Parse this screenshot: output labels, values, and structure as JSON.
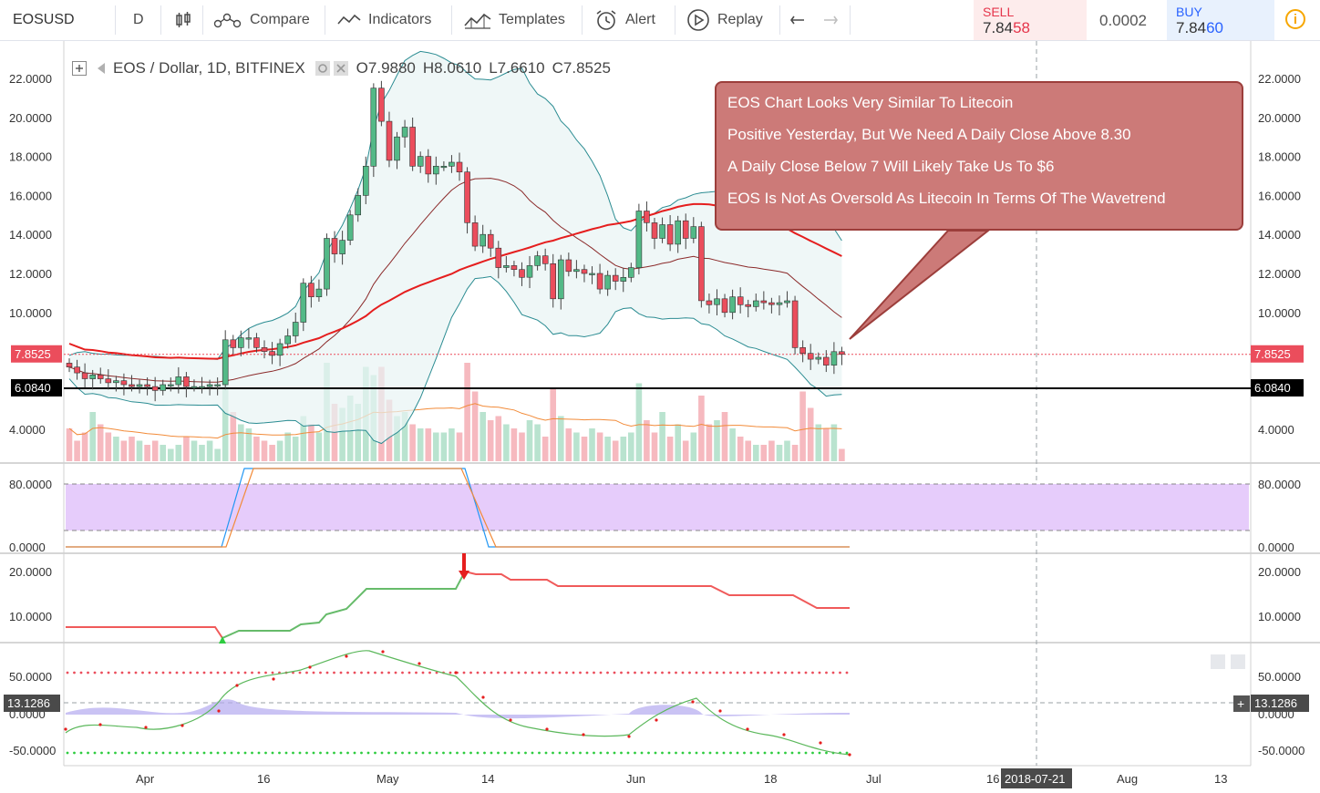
{
  "toolbar": {
    "symbol": "EOSUSD",
    "interval": "D",
    "compare": "Compare",
    "indicators": "Indicators",
    "templates": "Templates",
    "alert": "Alert",
    "replay": "Replay",
    "sell_label": "SELL",
    "sell_price_main": "7.84",
    "sell_price_big": "58",
    "spread": "0.0002",
    "buy_label": "BUY",
    "buy_price_main": "7.84",
    "buy_price_big": "60",
    "alert_icon_text": "i"
  },
  "legend": {
    "title": "EOS / Dollar, 1D, BITFINEX",
    "open": "O7.9880",
    "high": "H8.0610",
    "low": "L7.6610",
    "close": "C7.8525"
  },
  "note": {
    "lines": [
      "EOS Chart Looks Very Similar To Litecoin",
      "Positive Yesterday, But We Need A Daily Close Above 8.30",
      "A Daily Close Below 7 Will Likely Take Us To $6",
      "EOS Is Not As Oversold As Litecoin In Terms Of The Wavetrend"
    ]
  },
  "colors": {
    "up": "#53b987",
    "down": "#eb4d5c",
    "volume_up": "#b9e3cf",
    "volume_down": "#f6b9bf",
    "ma_red": "#e51e1e",
    "bb": "#2b8c92",
    "ma_brown": "#8b2a2a",
    "stoch_fill": "#e6ccfb",
    "accent": "#2196f3"
  },
  "price_axis": {
    "ticks": [
      "22.0000",
      "20.0000",
      "18.0000",
      "16.0000",
      "14.0000",
      "12.0000",
      "10.0000",
      "4.0000"
    ],
    "current_price": "7.8525",
    "hline_price": "6.0840"
  },
  "stoch_axis": {
    "ticks": [
      "80.0000",
      "0.0000"
    ]
  },
  "trend_axis": {
    "ticks": [
      "20.0000",
      "10.0000"
    ]
  },
  "wave_axis": {
    "ticks": [
      "50.0000",
      "0.0000",
      "-50.0000"
    ],
    "current": "13.1286"
  },
  "time_axis": {
    "labels": [
      "Apr",
      "16",
      "May",
      "14",
      "Jun",
      "18",
      "Jul",
      "16",
      "Aug",
      "13"
    ],
    "crosshair_date": "2018-07-21"
  },
  "chart_data": {
    "type": "candlestick",
    "series": [
      {
        "name": "EOS / Dollar, 1D, BITFINEX"
      }
    ],
    "price_range": [
      2.0,
      23.5
    ],
    "open": [
      7.4,
      7.2,
      6.9,
      6.6,
      6.8,
      6.6,
      6.4,
      6.5,
      6.3,
      6.2,
      6.3,
      6.2,
      6.0,
      6.3,
      6.3,
      6.7,
      6.2,
      6.2,
      6.2,
      6.3,
      6.3,
      8.6,
      8.2,
      8.7,
      8.7,
      8.2,
      8.0,
      7.8,
      8.4,
      8.8,
      9.5,
      11.5,
      10.8,
      11.2,
      13.8,
      13.0,
      13.7,
      15.0,
      16.0,
      17.5,
      21.5,
      19.8,
      17.8,
      19.0,
      19.5,
      17.5,
      18.0,
      17.1,
      17.5,
      17.5,
      17.7,
      17.2,
      14.6,
      13.4,
      14.0,
      13.3,
      12.3,
      12.4,
      12.2,
      11.8,
      12.4,
      12.9,
      12.5,
      10.7,
      12.7,
      12.1,
      12.2,
      12.0,
      12.0,
      11.2,
      11.9,
      11.6,
      11.8,
      12.3,
      15.2,
      14.6,
      13.8,
      14.5,
      13.5,
      14.7,
      13.8,
      14.4,
      10.6,
      10.4,
      10.7,
      10.0,
      10.8,
      10.4,
      10.3,
      10.6,
      10.5,
      10.4,
      10.5,
      10.6,
      8.2,
      7.9,
      7.6,
      7.7,
      7.3,
      7.99
    ],
    "close": [
      7.2,
      6.9,
      6.6,
      6.8,
      6.6,
      6.4,
      6.5,
      6.3,
      6.2,
      6.3,
      6.2,
      6.0,
      6.3,
      6.3,
      6.7,
      6.2,
      6.2,
      6.2,
      6.3,
      6.3,
      8.6,
      8.2,
      8.7,
      8.7,
      8.2,
      8.0,
      7.8,
      8.4,
      8.8,
      9.5,
      11.5,
      10.8,
      11.2,
      13.8,
      13.0,
      13.7,
      15.0,
      16.0,
      17.5,
      21.5,
      19.8,
      17.8,
      19.0,
      19.5,
      17.5,
      18.0,
      17.1,
      17.5,
      17.5,
      17.7,
      17.2,
      14.6,
      13.4,
      14.0,
      13.3,
      12.3,
      12.4,
      12.2,
      11.8,
      12.4,
      12.9,
      12.5,
      10.7,
      12.7,
      12.1,
      12.2,
      12.0,
      12.0,
      11.2,
      11.9,
      11.6,
      11.8,
      12.3,
      15.2,
      14.6,
      13.8,
      14.5,
      13.5,
      14.7,
      13.8,
      14.4,
      10.6,
      10.4,
      10.7,
      10.0,
      10.8,
      10.4,
      10.3,
      10.6,
      10.5,
      10.4,
      10.5,
      10.6,
      8.2,
      7.9,
      7.6,
      7.7,
      7.3,
      7.99,
      7.85
    ],
    "volume": [
      0.8,
      0.5,
      0.7,
      1.2,
      0.9,
      0.7,
      0.6,
      0.5,
      0.6,
      0.5,
      0.4,
      0.5,
      0.4,
      0.3,
      0.4,
      0.6,
      0.5,
      0.4,
      0.5,
      0.3,
      2.5,
      1.2,
      0.9,
      0.8,
      0.6,
      0.5,
      0.4,
      0.5,
      0.7,
      0.6,
      1.1,
      0.9,
      0.7,
      2.4,
      1.4,
      1.3,
      1.6,
      1.4,
      2.3,
      2.1,
      2.3,
      1.5,
      1.1,
      1.2,
      0.9,
      0.8,
      0.8,
      0.7,
      0.7,
      0.8,
      0.7,
      2.4,
      1.7,
      1.2,
      1.0,
      1.1,
      0.9,
      0.8,
      0.7,
      1.0,
      0.9,
      0.6,
      1.8,
      1.1,
      0.8,
      0.7,
      0.6,
      0.8,
      0.7,
      0.6,
      0.5,
      0.6,
      0.7,
      1.9,
      1.0,
      0.7,
      1.2,
      0.6,
      0.9,
      0.5,
      0.7,
      1.6,
      0.9,
      1.0,
      1.2,
      0.8,
      0.6,
      0.5,
      0.4,
      0.4,
      0.5,
      0.4,
      0.5,
      0.4,
      1.7,
      1.3,
      0.9,
      0.8,
      0.9,
      0.3
    ]
  }
}
